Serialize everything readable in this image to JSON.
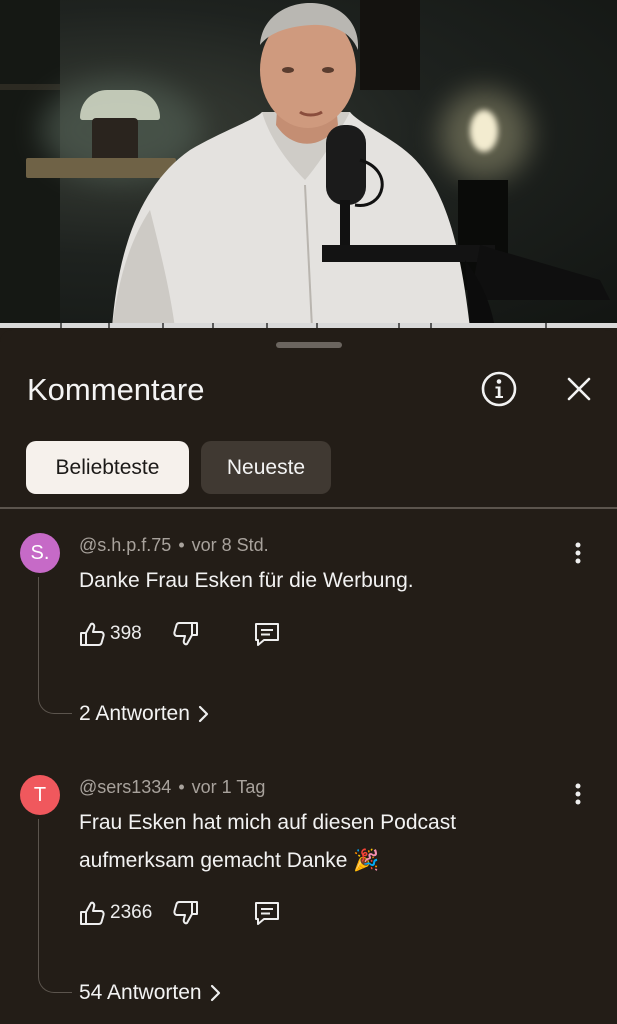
{
  "sheet": {
    "title": "Kommentare",
    "filters": [
      {
        "label": "Beliebteste",
        "active": true
      },
      {
        "label": "Neueste",
        "active": false
      }
    ]
  },
  "icons": {
    "info": "info-circle-icon",
    "close": "close-icon",
    "more": "more-vertical-icon",
    "like": "thumbs-up-icon",
    "dislike": "thumbs-down-icon",
    "reply": "reply-comment-icon",
    "chevron": "chevron-right-icon"
  },
  "colors": {
    "background": "#231d17",
    "chip_active": "#f6f1ec",
    "chip_idle": "#403932",
    "avatar_1": "#c66ac7",
    "avatar_2": "#f0585d"
  },
  "comments": [
    {
      "avatar_letter": "S.",
      "author": "@s.h.p.f.75",
      "time": "vor 8 Std.",
      "text": "Danke Frau Esken für die Werbung.",
      "likes": "398",
      "replies": "2 Antworten"
    },
    {
      "avatar_letter": "T",
      "author": "@sers1334",
      "time": "vor 1 Tag",
      "text": "Frau Esken hat mich auf diesen Podcast aufmerksam gemacht Danke 🎉",
      "likes": "2366",
      "replies": "54 Antworten"
    }
  ]
}
